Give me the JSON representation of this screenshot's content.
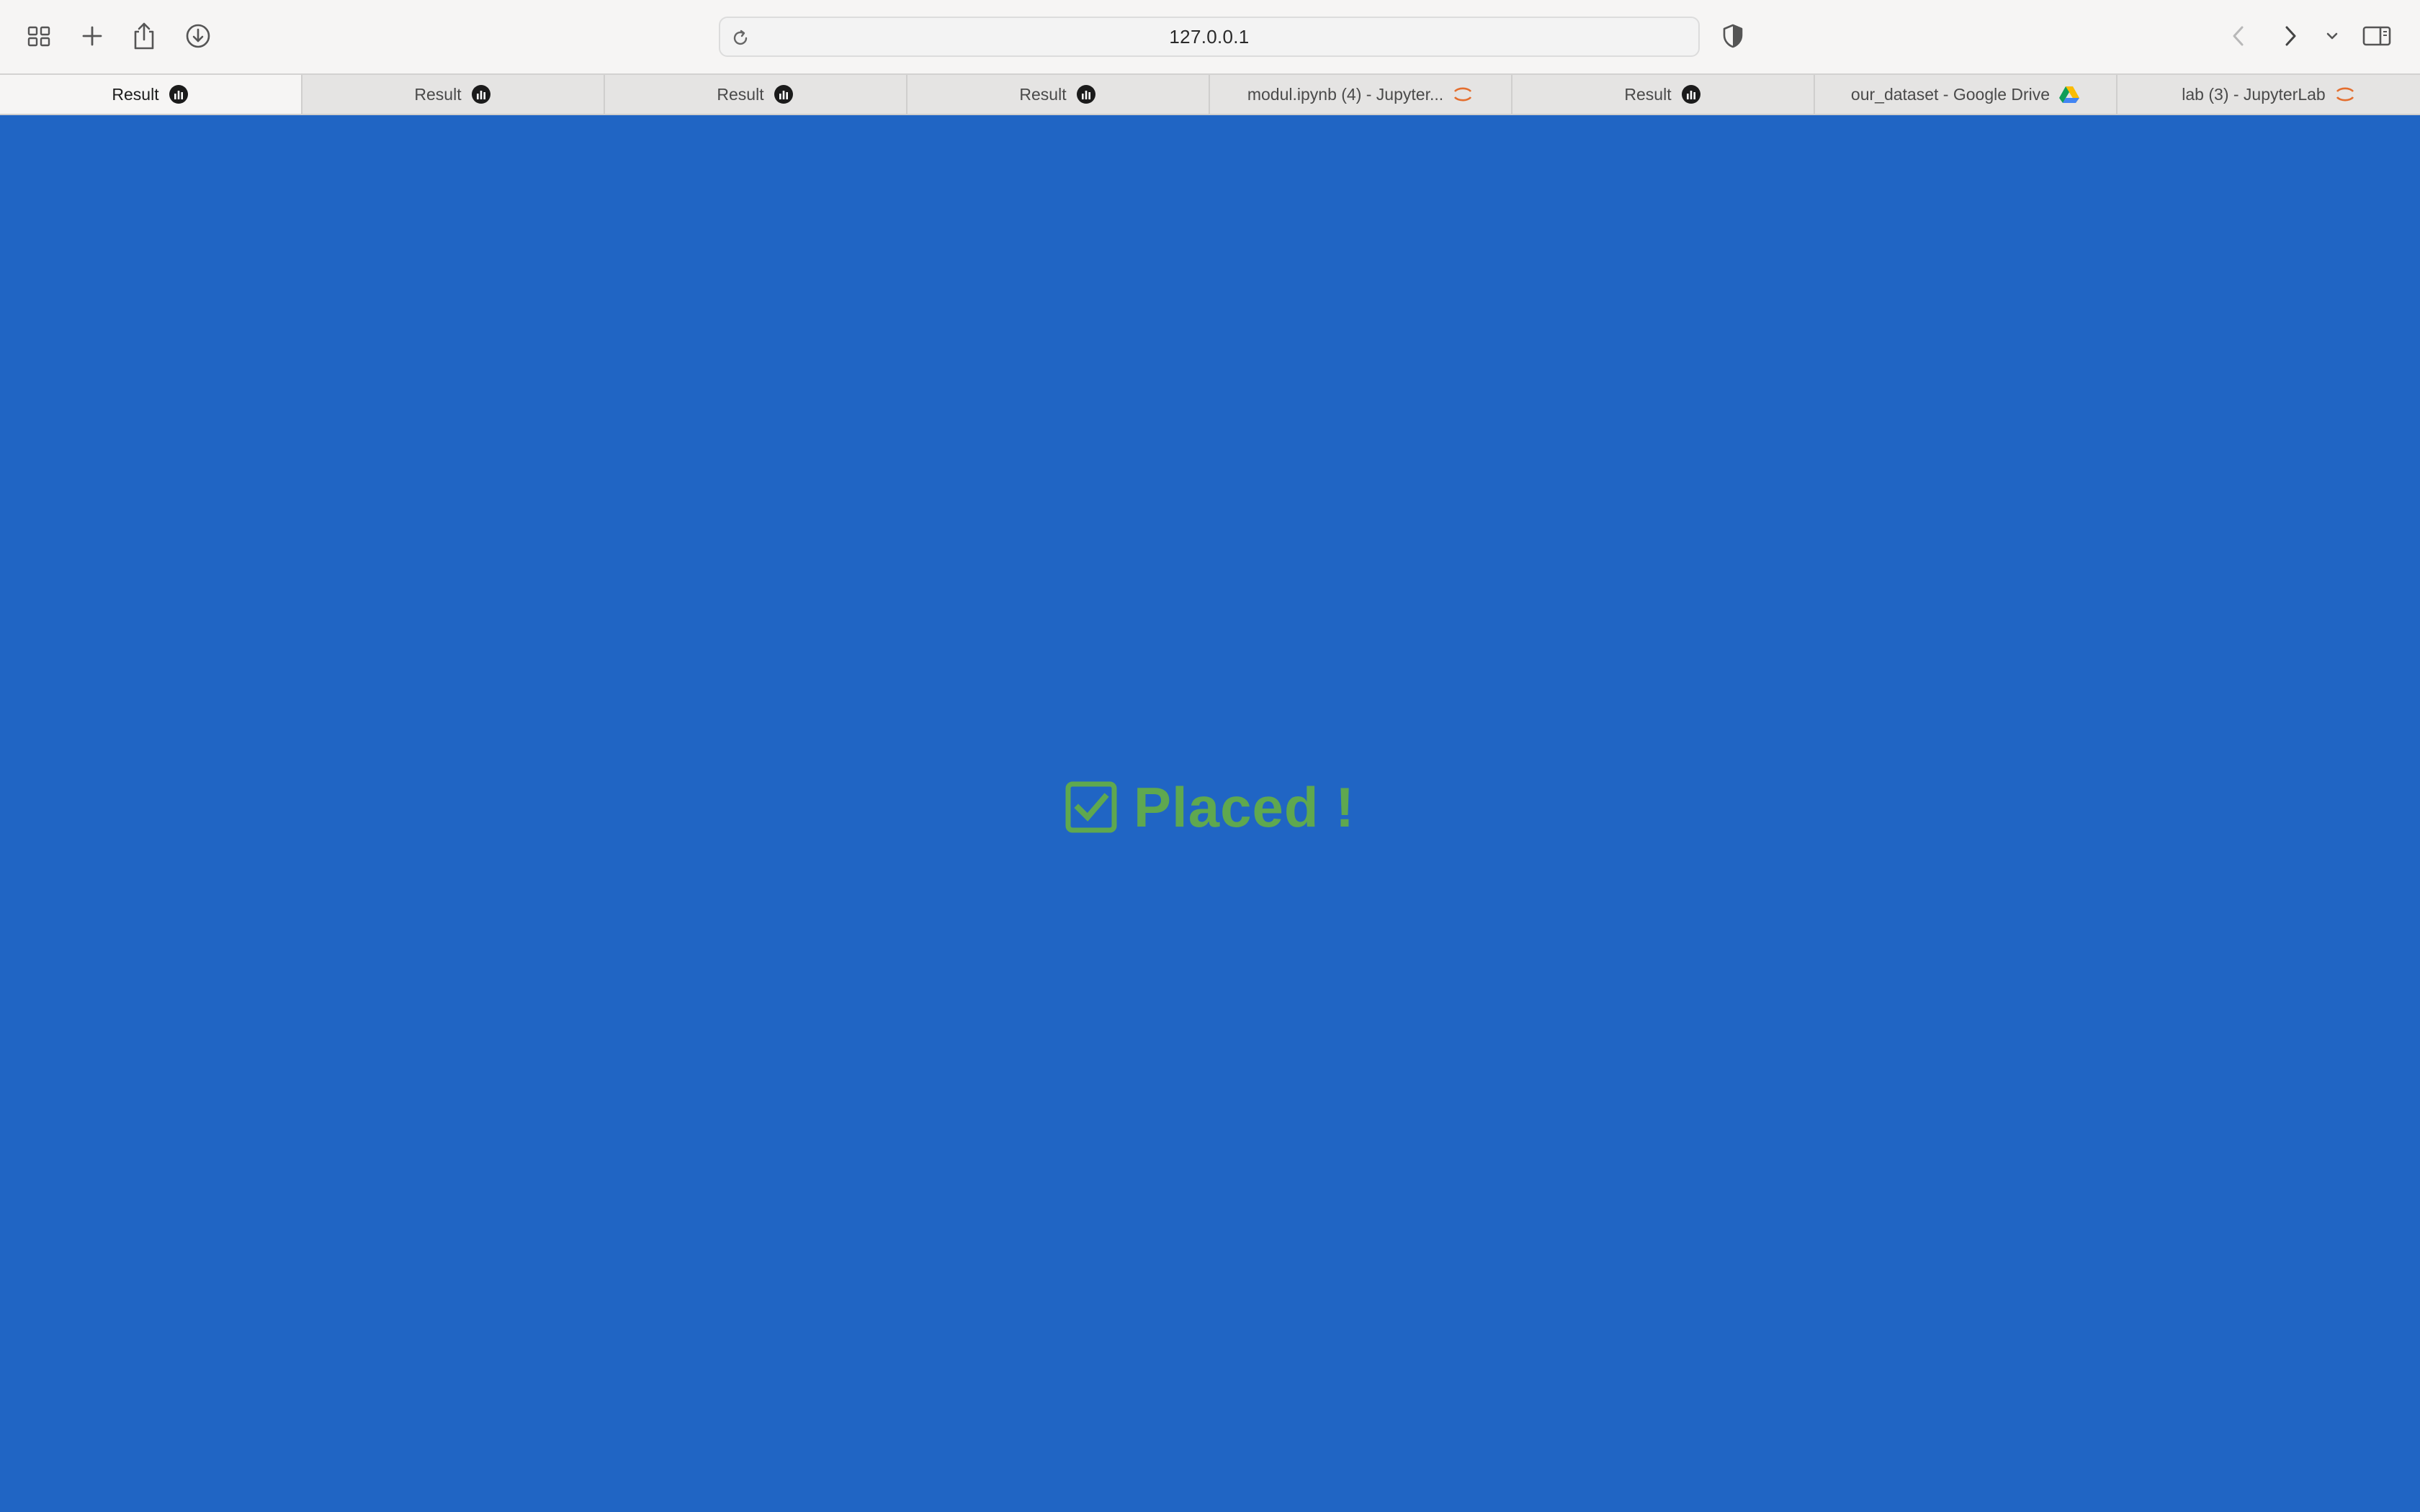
{
  "browser": {
    "toolbar": {
      "tab_overview_icon": "grid-icon",
      "new_tab_icon": "plus-icon",
      "share_icon": "share-icon",
      "downloads_icon": "download-icon",
      "privacy_icon": "shield-icon",
      "back_icon": "chevron-left-icon",
      "forward_icon": "chevron-right-icon",
      "more_icon": "chevron-down-icon",
      "sidebar_icon": "sidebar-icon"
    },
    "address_bar": {
      "url": "127.0.0.1",
      "reload_icon": "reload-icon"
    },
    "tabs": [
      {
        "label": "Result",
        "favicon": "result-chart-icon",
        "active": true
      },
      {
        "label": "Result",
        "favicon": "result-chart-icon",
        "active": false
      },
      {
        "label": "Result",
        "favicon": "result-chart-icon",
        "active": false
      },
      {
        "label": "Result",
        "favicon": "result-chart-icon",
        "active": false
      },
      {
        "label": "modul.ipynb (4) - Jupyter...",
        "favicon": "jupyter-icon",
        "active": false
      },
      {
        "label": "Result",
        "favicon": "result-chart-icon",
        "active": false
      },
      {
        "label": "our_dataset - Google Drive",
        "favicon": "google-drive-icon",
        "active": false
      },
      {
        "label": "lab (3) - JupyterLab",
        "favicon": "jupyter-icon",
        "active": false
      }
    ]
  },
  "page": {
    "background_color": "#2065c4",
    "status_message": "Placed !",
    "status_icon": "checkbox-checked-icon",
    "status_color": "#5fa84f"
  }
}
